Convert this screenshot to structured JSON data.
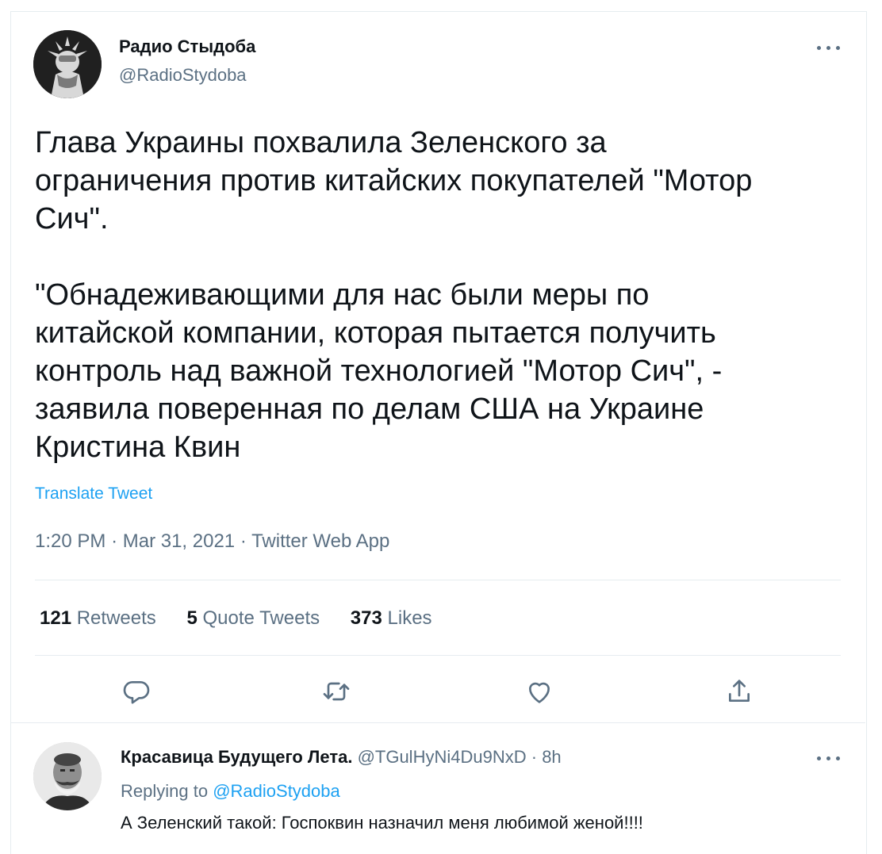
{
  "tweet": {
    "author_name": "Радио Стыдоба",
    "author_handle": "@RadioStydoba",
    "paragraphs": [
      "Глава Украины похвалила Зеленского за\nограничения против китайских покупателей \"Мотор\nСич\".",
      "\"Обнадеживающими для нас были меры по\nкитайской компании, которая пытается получить\nконтроль над важной технологией \"Мотор Сич\", -\nзаявила поверенная по делам США на Украине\nКристина Квин"
    ],
    "translate_label": "Translate Tweet",
    "time": "1:20 PM",
    "date": "Mar 31, 2021",
    "source": "Twitter Web App",
    "separator": "·",
    "stats": {
      "retweets_count": "121",
      "retweets_label": "Retweets",
      "quotes_count": "5",
      "quotes_label": "Quote Tweets",
      "likes_count": "373",
      "likes_label": "Likes"
    },
    "actions": [
      "reply-icon",
      "retweet-icon",
      "like-icon",
      "share-icon"
    ]
  },
  "reply": {
    "author_name": "Красавица Будущего Лета.",
    "author_handle": "@TGulHyNi4Du9NxD",
    "time_ago": "8h",
    "separator": "·",
    "replying_prefix": "Replying to",
    "replying_to": "@RadioStydoba",
    "text": "А Зеленский такой: Госпоквин назначил меня любимой женой!!!!"
  },
  "colors": {
    "link": "#1da1f2",
    "secondary_text": "#5b7083",
    "primary_text": "#0f1419",
    "divider": "#e6ecf0"
  }
}
